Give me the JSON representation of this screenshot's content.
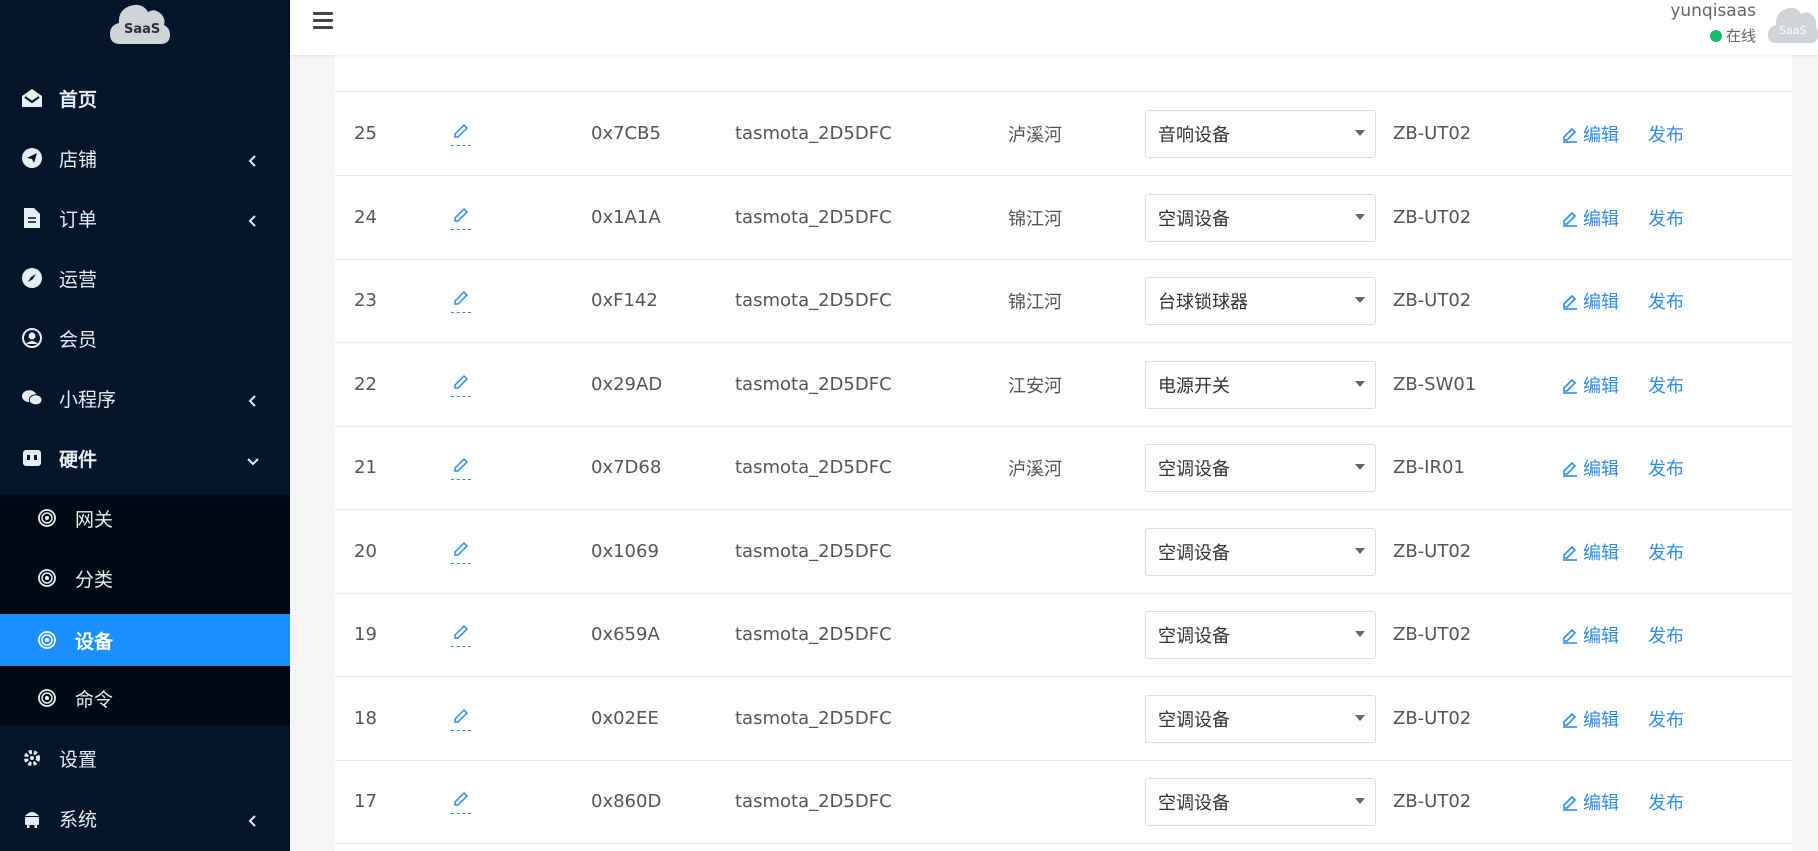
{
  "sidebar": {
    "logo_text": "SaaS",
    "menu": [
      {
        "label": "首页",
        "icon": "home-icon",
        "has_arrow": false
      },
      {
        "label": "店铺",
        "icon": "send-icon",
        "has_arrow": true
      },
      {
        "label": "订单",
        "icon": "document-icon",
        "has_arrow": true
      },
      {
        "label": "运营",
        "icon": "compass-icon",
        "has_arrow": false
      },
      {
        "label": "会员",
        "icon": "user-icon",
        "has_arrow": false
      },
      {
        "label": "小程序",
        "icon": "wechat-icon",
        "has_arrow": true
      },
      {
        "label": "硬件",
        "icon": "hardware-icon",
        "has_arrow": true
      }
    ],
    "submenu": [
      {
        "label": "网关",
        "icon": "target-icon",
        "active": false
      },
      {
        "label": "分类",
        "icon": "target-icon",
        "active": false
      },
      {
        "label": "设备",
        "icon": "target-icon",
        "active": true
      },
      {
        "label": "命令",
        "icon": "target-icon",
        "active": false
      }
    ],
    "bottom_menu": [
      {
        "label": "设置",
        "icon": "gear-icon",
        "has_arrow": false
      },
      {
        "label": "系统",
        "icon": "android-icon",
        "has_arrow": true
      }
    ]
  },
  "header": {
    "username": "yunqisaas",
    "status": "在线",
    "avatar_text": "SaaS",
    "status_color": "#19be6b"
  },
  "table": {
    "rows": [
      {
        "id": "25",
        "addr": "0x7CB5",
        "name": "tasmota_2D5DFC",
        "location": "泸溪河",
        "type": "音响设备",
        "model": "ZB-UT02"
      },
      {
        "id": "24",
        "addr": "0x1A1A",
        "name": "tasmota_2D5DFC",
        "location": "锦江河",
        "type": "空调设备",
        "model": "ZB-UT02"
      },
      {
        "id": "23",
        "addr": "0xF142",
        "name": "tasmota_2D5DFC",
        "location": "锦江河",
        "type": "台球锁球器",
        "model": "ZB-UT02"
      },
      {
        "id": "22",
        "addr": "0x29AD",
        "name": "tasmota_2D5DFC",
        "location": "江安河",
        "type": "电源开关",
        "model": "ZB-SW01"
      },
      {
        "id": "21",
        "addr": "0x7D68",
        "name": "tasmota_2D5DFC",
        "location": "泸溪河",
        "type": "空调设备",
        "model": "ZB-IR01"
      },
      {
        "id": "20",
        "addr": "0x1069",
        "name": "tasmota_2D5DFC",
        "location": "",
        "type": "空调设备",
        "model": "ZB-UT02"
      },
      {
        "id": "19",
        "addr": "0x659A",
        "name": "tasmota_2D5DFC",
        "location": "",
        "type": "空调设备",
        "model": "ZB-UT02"
      },
      {
        "id": "18",
        "addr": "0x02EE",
        "name": "tasmota_2D5DFC",
        "location": "",
        "type": "空调设备",
        "model": "ZB-UT02"
      },
      {
        "id": "17",
        "addr": "0x860D",
        "name": "tasmota_2D5DFC",
        "location": "",
        "type": "空调设备",
        "model": "ZB-UT02"
      }
    ],
    "edit_label": "编辑",
    "publish_label": "发布",
    "link_color": "#2d8cf0"
  }
}
